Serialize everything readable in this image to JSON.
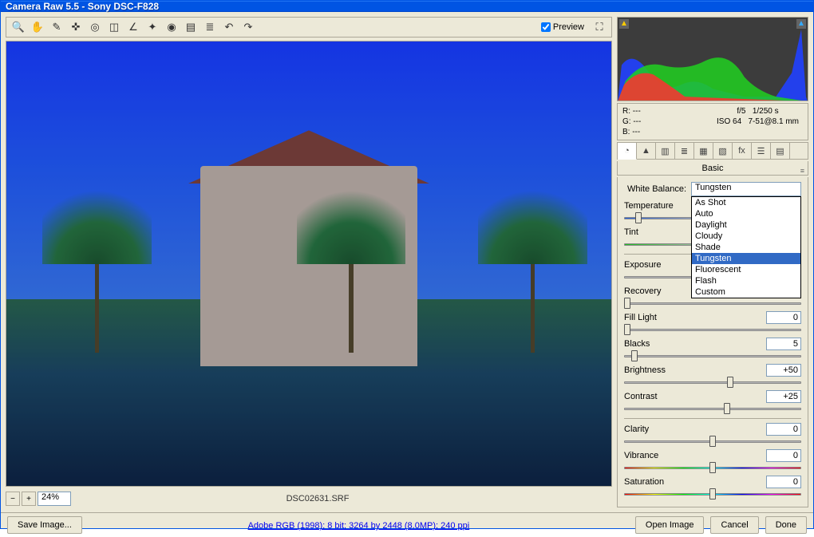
{
  "window": {
    "title": "Camera Raw 5.5  -  Sony DSC-F828"
  },
  "toolbar": {
    "tools": [
      "zoom",
      "hand",
      "wb-picker",
      "color-sampler",
      "target",
      "crop",
      "straighten",
      "retouch",
      "redeye",
      "prefs",
      "list",
      "rotate-ccw",
      "rotate-cw"
    ],
    "preview_label": "Preview",
    "preview_checked": true,
    "fullscreen_icon": "fullscreen-icon"
  },
  "status": {
    "zoom_minus": "−",
    "zoom_plus": "+",
    "zoom_value": "24%",
    "filename": "DSC02631.SRF"
  },
  "histogram": {
    "shadow_clip_icon": "▲",
    "highlight_clip_icon": "▲"
  },
  "meta": {
    "r": "R: ---",
    "g": "G: ---",
    "b": "B: ---",
    "aperture": "f/5",
    "shutter": "1/250 s",
    "iso": "ISO 64",
    "lens": "7-51@8.1 mm"
  },
  "tabs": {
    "active": 0,
    "icons": [
      "◔",
      "▲",
      "▥",
      "≣",
      "▦",
      "▧",
      "fx",
      "☰",
      "▤"
    ]
  },
  "panel": {
    "title": "Basic",
    "menu_icon": "≡"
  },
  "wb": {
    "label": "White Balance:",
    "value": "Tungsten",
    "options": [
      "As Shot",
      "Auto",
      "Daylight",
      "Cloudy",
      "Shade",
      "Tungsten",
      "Fluorescent",
      "Flash",
      "Custom"
    ],
    "selected_index": 5
  },
  "sliders": {
    "temperature": {
      "label": "Temperature",
      "value": "",
      "pos": 8
    },
    "tint": {
      "label": "Tint",
      "value": "",
      "pos": 45
    },
    "exposure": {
      "label": "Exposure",
      "value": "",
      "pos": 60
    },
    "recovery": {
      "label": "Recovery",
      "value": "0",
      "pos": 2
    },
    "filllight": {
      "label": "Fill Light",
      "value": "0",
      "pos": 2
    },
    "blacks": {
      "label": "Blacks",
      "value": "5",
      "pos": 6
    },
    "brightness": {
      "label": "Brightness",
      "value": "+50",
      "pos": 60
    },
    "contrast": {
      "label": "Contrast",
      "value": "+25",
      "pos": 58
    },
    "clarity": {
      "label": "Clarity",
      "value": "0",
      "pos": 50
    },
    "vibrance": {
      "label": "Vibrance",
      "value": "0",
      "pos": 50
    },
    "saturation": {
      "label": "Saturation",
      "value": "0",
      "pos": 50
    }
  },
  "bottom": {
    "save": "Save Image...",
    "workflow": "Adobe RGB (1998); 8 bit; 3264 by 2448 (8.0MP); 240 ppi",
    "open": "Open Image",
    "cancel": "Cancel",
    "done": "Done"
  }
}
